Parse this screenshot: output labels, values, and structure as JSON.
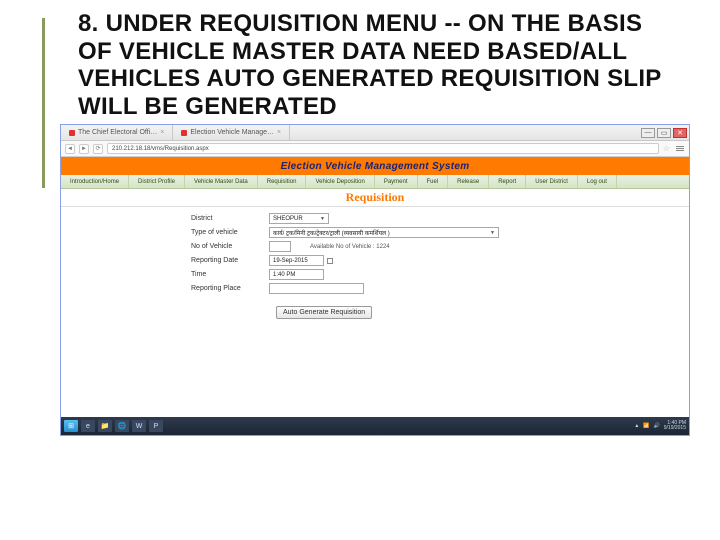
{
  "title": "8. UNDER REQUISITION MENU -- ON THE BASIS OF VEHICLE MASTER DATA NEED BASED/ALL VEHICLES AUTO GENERATED REQUISITION SLIP WILL BE GENERATED",
  "browser": {
    "tabs": [
      {
        "label": "The Chief Electoral Offi…"
      },
      {
        "label": "Election Vehicle Manage…"
      }
    ],
    "address": "210.212.18.18/vms/Requisition.aspx"
  },
  "app": {
    "banner": "Election Vehicle Management System",
    "nav": [
      "Introduction/Home",
      "District Profile",
      "Vehicle Master Data",
      "Requisition",
      "Vehicle Deposition",
      "Payment",
      "Fuel",
      "Release",
      "Report",
      "User District",
      "Log out"
    ],
    "section": "Requisition"
  },
  "form": {
    "district_label": "District",
    "district_value": "SHEOPUR",
    "type_label": "Type of vehicle",
    "type_value": "कार्य/ ट्रक/मिनी ट्रक/ट्रेक्टर/ट्राली (व्यवसायी कमर्शियल )",
    "no_label": "No of Vehicle",
    "no_value": "",
    "available_label": "Available No of Vehicle : ",
    "available_value": "1224",
    "date_label": "Reporting Date",
    "date_value": "19-Sep-2015",
    "time_label": "Time",
    "time_value": "1:40 PM",
    "place_label": "Reporting Place",
    "place_value": "",
    "button": "Auto Generate Requisition"
  },
  "taskbar": {
    "time": "1:40 PM",
    "date": "9/19/2015"
  }
}
